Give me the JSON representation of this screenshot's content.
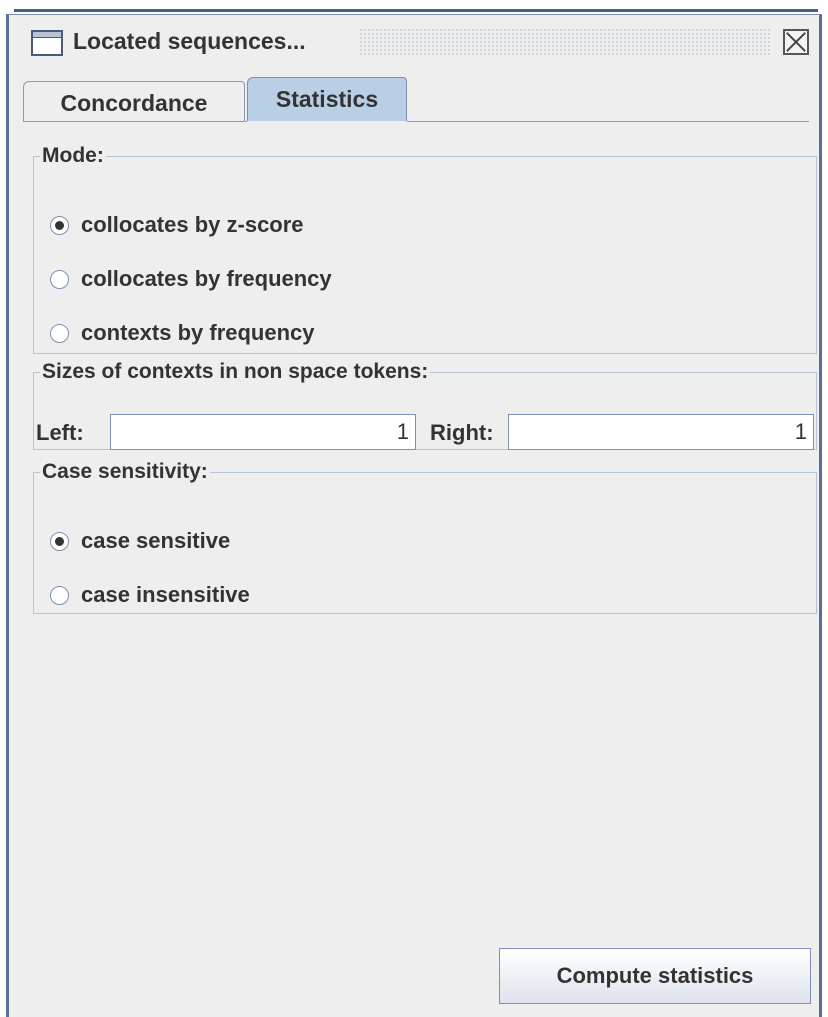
{
  "window": {
    "title": "Located sequences...",
    "icons": {
      "window": "window-icon",
      "close": "close-icon"
    }
  },
  "tabs": [
    {
      "label": "Concordance",
      "selected": false
    },
    {
      "label": "Statistics",
      "selected": true
    }
  ],
  "mode": {
    "legend": "Mode:",
    "options": [
      {
        "label": "collocates by z-score",
        "checked": true
      },
      {
        "label": "collocates by frequency",
        "checked": false
      },
      {
        "label": "contexts by frequency",
        "checked": false
      }
    ]
  },
  "sizes": {
    "legend": "Sizes of contexts in non space tokens:",
    "left_label": "Left:",
    "left_value": "1",
    "right_label": "Right:",
    "right_value": "1"
  },
  "case": {
    "legend": "Case sensitivity:",
    "options": [
      {
        "label": "case sensitive",
        "checked": true
      },
      {
        "label": "case insensitive",
        "checked": false
      }
    ]
  },
  "compute_button": "Compute statistics",
  "colors": {
    "selected_tab": "#b8cfe5",
    "frame": "#5a6f96",
    "panel_bg": "#eeeeee"
  }
}
